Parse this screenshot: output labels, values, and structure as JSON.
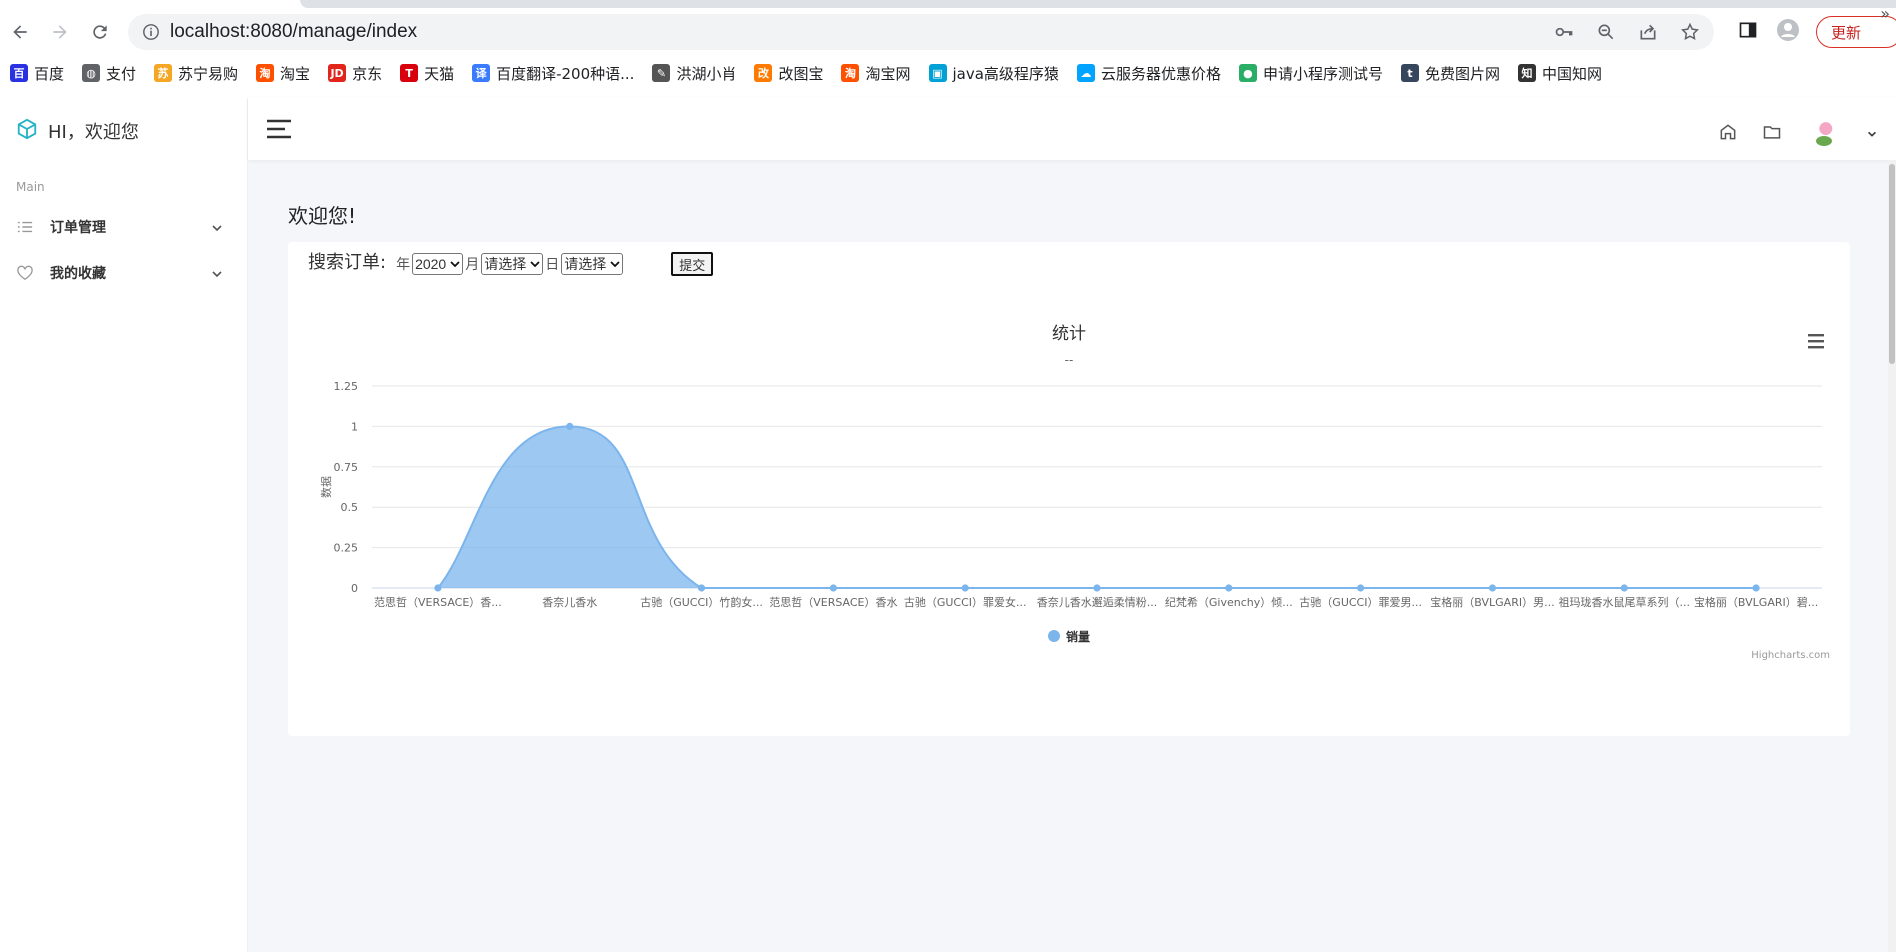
{
  "browser": {
    "url": "localhost:8080/manage/index",
    "update_label": "更新",
    "bookmarks": [
      {
        "label": "百度",
        "icon": "baidu-icon",
        "color": "#2932e1"
      },
      {
        "label": "支付",
        "icon": "globe-icon",
        "color": "#5f6368"
      },
      {
        "label": "苏宁易购",
        "icon": "suning-icon",
        "color": "#f5a623"
      },
      {
        "label": "淘宝",
        "icon": "taobao-icon",
        "color": "#ff5000"
      },
      {
        "label": "京东",
        "icon": "jd-icon",
        "color": "#e1251b"
      },
      {
        "label": "天猫",
        "icon": "tmall-icon",
        "color": "#d8000c"
      },
      {
        "label": "百度翻译-200种语...",
        "icon": "translate-icon",
        "color": "#3b7cff"
      },
      {
        "label": "洪湖小肖",
        "icon": "bird-icon",
        "color": "#555555"
      },
      {
        "label": "改图宝",
        "icon": "gaitubao-icon",
        "color": "#ff7a00"
      },
      {
        "label": "淘宝网",
        "icon": "taobao-icon",
        "color": "#ff5000"
      },
      {
        "label": "java高级程序猿",
        "icon": "bilibili-icon",
        "color": "#00a1d6"
      },
      {
        "label": "云服务器优惠价格",
        "icon": "cloud-icon",
        "color": "#00a3ff"
      },
      {
        "label": "申请小程序测试号",
        "icon": "wechat-icon",
        "color": "#2aae67"
      },
      {
        "label": "免费图片网",
        "icon": "tumblr-icon",
        "color": "#36465d"
      },
      {
        "label": "中国知网",
        "icon": "cnki-icon",
        "color": "#333333"
      }
    ]
  },
  "sidebar": {
    "brand": "HI，欢迎您",
    "section": "Main",
    "items": [
      {
        "label": "订单管理",
        "icon": "list-icon"
      },
      {
        "label": "我的收藏",
        "icon": "heart-icon"
      }
    ]
  },
  "main": {
    "welcome": "欢迎您!",
    "search": {
      "label": "搜索订单:",
      "year_unit": "年",
      "year_value": "2020",
      "month_unit": "月",
      "month_value": "请选择",
      "day_unit": "日",
      "day_value": "请选择",
      "submit_label": "提交"
    }
  },
  "chart_data": {
    "type": "area",
    "title": "统计",
    "subtitle": "--",
    "ylabel": "数据",
    "xlabel": "",
    "ylim": [
      0,
      1.25
    ],
    "yticks": [
      "0",
      "0.25",
      "0.5",
      "0.75",
      "1",
      "1.25"
    ],
    "grid": true,
    "legend_position": "bottom-center",
    "credits": "Highcharts.com",
    "categories": [
      "范思哲（VERSACE）香...",
      "香奈儿香水",
      "古驰（GUCCI）竹韵女...",
      "范思哲（VERSACE）香水",
      "古驰（GUCCI）罪爱女...",
      "香奈儿香水邂逅柔情粉...",
      "纪梵希（Givenchy）倾...",
      "古驰（GUCCI）罪爱男...",
      "宝格丽（BVLGARI）男...",
      "祖玛珑香水鼠尾草系列（...",
      "宝格丽（BVLGARI）碧..."
    ],
    "series": [
      {
        "name": "销量",
        "color": "#7cb5ec",
        "values": [
          0,
          1,
          0,
          0,
          0,
          0,
          0,
          0,
          0,
          0,
          0
        ]
      }
    ]
  }
}
